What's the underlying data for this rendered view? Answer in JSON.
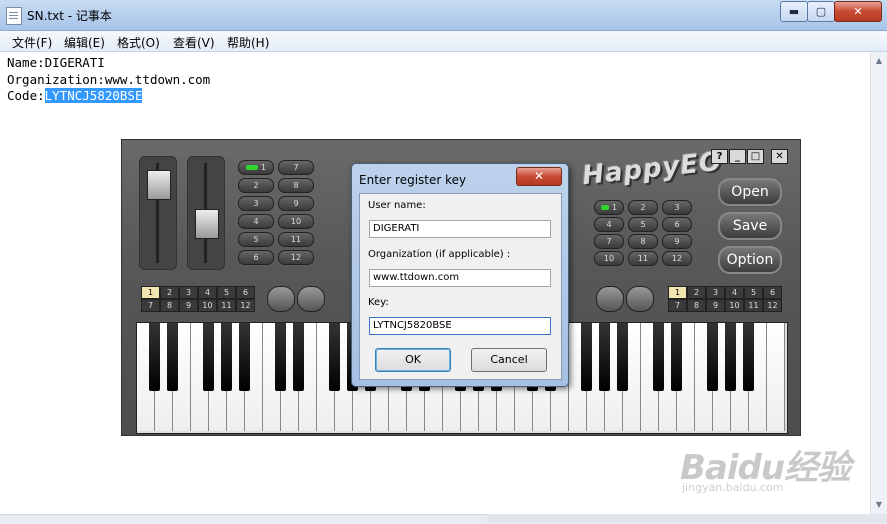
{
  "notepad": {
    "title": "SN.txt - 记事本",
    "controls": {
      "min": "▬",
      "max": "▢",
      "close": "✕"
    },
    "menu": [
      "文件(F)",
      "编辑(E)",
      "格式(O)",
      "查看(V)",
      "帮助(H)"
    ],
    "lines": {
      "name": "Name:DIGERATI",
      "org": "Organization:www.ttdown.com",
      "code_prefix": "Code:",
      "code_value": "LYTNCJ5820BSE"
    }
  },
  "happyeo": {
    "logo": "HappyEO",
    "title_buttons": [
      "?",
      "_",
      "□",
      "✕"
    ],
    "side_buttons": [
      "Open",
      "Save",
      "Option"
    ],
    "left_pills": [
      "1",
      "2",
      "3",
      "4",
      "5",
      "6",
      "7",
      "8",
      "9",
      "10",
      "11",
      "12"
    ],
    "right_pills": [
      "1",
      "2",
      "3",
      "4",
      "5",
      "6",
      "7",
      "8",
      "9",
      "10",
      "11",
      "12"
    ],
    "left_small": [
      "1",
      "2",
      "3",
      "4",
      "5",
      "6",
      "7",
      "8",
      "9",
      "10",
      "11",
      "12"
    ],
    "right_small": [
      "1",
      "2",
      "3",
      "4",
      "5",
      "6",
      "7",
      "8",
      "9",
      "10",
      "11",
      "12"
    ]
  },
  "dialog": {
    "title": "Enter register key",
    "close": "✕",
    "user_label": "User name:",
    "user_value": "DIGERATI",
    "org_label": "Organization (if applicable) :",
    "org_value": "www.ttdown.com",
    "key_label": "Key:",
    "key_value": "LYTNCJ5820BSE",
    "ok": "OK",
    "cancel": "Cancel"
  },
  "watermark": {
    "brand": "Baidu经验",
    "url": "jingyan.baidu.com"
  }
}
